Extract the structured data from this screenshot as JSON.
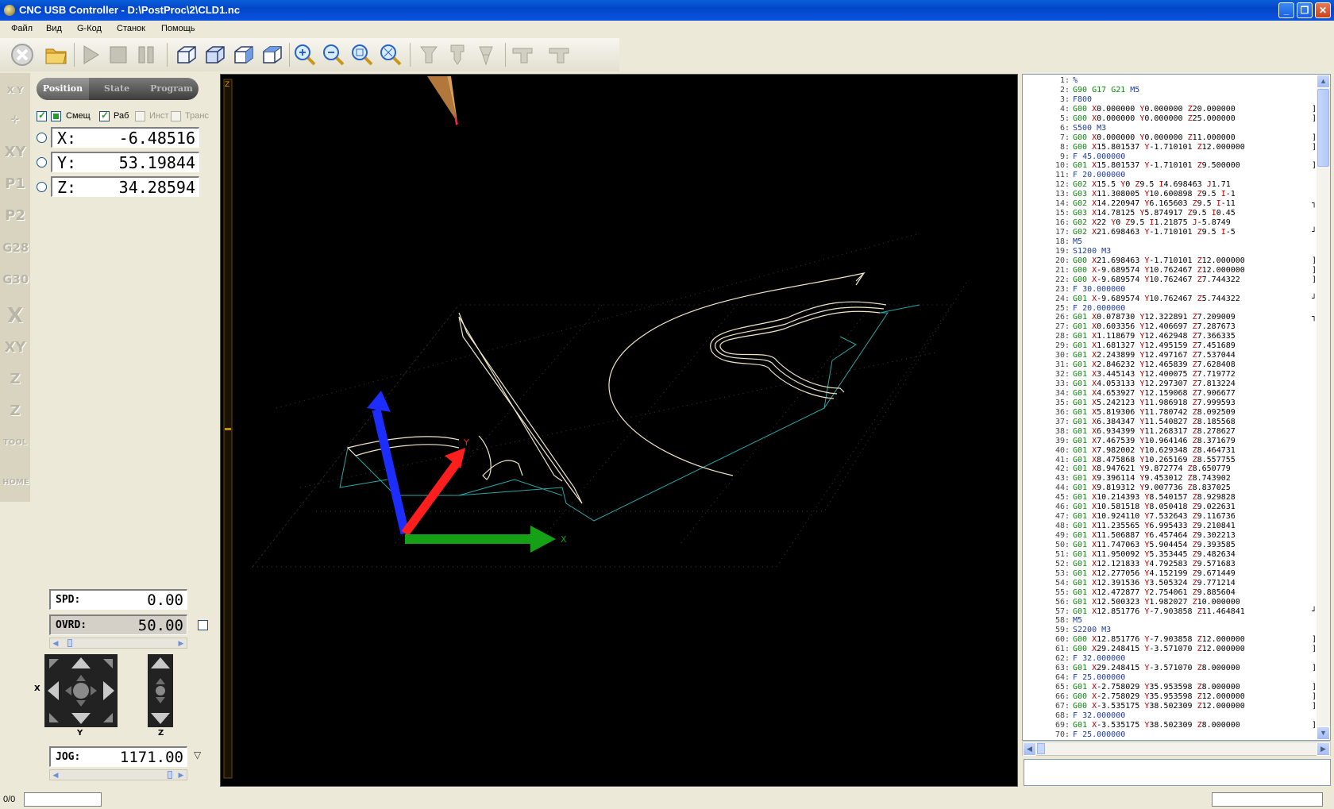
{
  "window": {
    "title": "CNC USB Controller - D:\\PostProc\\2\\CLD1.nc"
  },
  "menu": [
    "Файл",
    "Вид",
    "G-Код",
    "Станок",
    "Помощь"
  ],
  "toolbar": {
    "buttons": [
      "stop-icon",
      "open-folder-icon",
      "play-icon",
      "stop-square-icon",
      "pause-icon",
      "view-3d-icon",
      "view-front-icon",
      "view-side-icon",
      "view-iso-icon",
      "zoom-in-icon",
      "zoom-out-icon",
      "zoom-fit-icon",
      "zoom-window-icon",
      "probe-icon",
      "tool-change-icon",
      "spindle-icon",
      "machine-icon",
      "machine2-icon"
    ]
  },
  "left_sidebar": {
    "icons": [
      "X Y",
      "XY",
      "P1",
      "P2",
      "G28",
      "G30",
      "X",
      "XY",
      "Z",
      "Z",
      "TOOL",
      "HOME"
    ]
  },
  "tabs": {
    "position": "Position",
    "state": "State",
    "program": "Program"
  },
  "coords": {
    "options": {
      "offset": "Смещ",
      "work": "Раб",
      "tool": "Инст",
      "trans": "Транс"
    },
    "x": {
      "label": "X:",
      "value": "-6.48516"
    },
    "y": {
      "label": "Y:",
      "value": "53.19844"
    },
    "z": {
      "label": "Z:",
      "value": "34.28594"
    }
  },
  "spindle": {
    "spd_label": "SPD:",
    "spd_value": "0.00",
    "ovrd_label": "OVRD:",
    "ovrd_value": "50.00"
  },
  "jog": {
    "x_label": "X",
    "y_label": "Y",
    "z_label": "Z",
    "label": "JOG:",
    "value": "1171.00"
  },
  "viewport": {
    "z_axis_label": "Z",
    "axis_x": "X",
    "axis_y": "Y"
  },
  "gcode": [
    {
      "n": "1:",
      "t": "%"
    },
    {
      "n": "2:",
      "t": "G90 G17 G21 M5"
    },
    {
      "n": "3:",
      "t": "F800"
    },
    {
      "n": "4:",
      "t": "G00 X0.000000 Y0.000000 Z20.000000",
      "b": "]"
    },
    {
      "n": "5:",
      "t": "G00 X0.000000 Y0.000000 Z25.000000",
      "b": "]"
    },
    {
      "n": "6:",
      "t": "S500 M3"
    },
    {
      "n": "7:",
      "t": "G00 X0.000000 Y0.000000 Z11.000000",
      "b": "]"
    },
    {
      "n": "8:",
      "t": "G00 X15.801537 Y-1.710101 Z12.000000",
      "b": "]"
    },
    {
      "n": "9:",
      "t": "F 45.000000"
    },
    {
      "n": "10:",
      "t": "G01 X15.801537 Y-1.710101 Z9.500000",
      "b": "]"
    },
    {
      "n": "11:",
      "t": "F 20.000000"
    },
    {
      "n": "12:",
      "t": "G02 X15.5 Y0 Z9.5 I4.698463 J1.71"
    },
    {
      "n": "13:",
      "t": "G03 X11.308005 Y10.600898 Z9.5 I-1"
    },
    {
      "n": "14:",
      "t": "G02 X14.220947 Y6.165603 Z9.5 I-11",
      "b": "┐"
    },
    {
      "n": "15:",
      "t": "G03 X14.78125 Y5.874917 Z9.5 I0.45"
    },
    {
      "n": "16:",
      "t": "G02 X22 Y0 Z9.5 I1.21875 J-5.8749"
    },
    {
      "n": "17:",
      "t": "G02 X21.698463 Y-1.710101 Z9.5 I-5",
      "b": "┘"
    },
    {
      "n": "18:",
      "t": "M5"
    },
    {
      "n": "19:",
      "t": "S1200 M3"
    },
    {
      "n": "20:",
      "t": "G00 X21.698463 Y-1.710101 Z12.000000",
      "b": "]"
    },
    {
      "n": "21:",
      "t": "G00 X-9.689574 Y10.762467 Z12.000000",
      "b": "]"
    },
    {
      "n": "22:",
      "t": "G00 X-9.689574 Y10.762467 Z7.744322",
      "b": "]"
    },
    {
      "n": "23:",
      "t": "F 30.000000"
    },
    {
      "n": "24:",
      "t": "G01 X-9.689574 Y10.762467 Z5.744322",
      "b": "┘"
    },
    {
      "n": "25:",
      "t": "F 20.000000"
    },
    {
      "n": "26:",
      "t": "G01 X0.078730 Y12.322891 Z7.209009",
      "b": "┐"
    },
    {
      "n": "27:",
      "t": "G01 X0.603356 Y12.406697 Z7.287673"
    },
    {
      "n": "28:",
      "t": "G01 X1.118679 Y12.462948 Z7.366335"
    },
    {
      "n": "29:",
      "t": "G01 X1.681327 Y12.495159 Z7.451689"
    },
    {
      "n": "30:",
      "t": "G01 X2.243899 Y12.497167 Z7.537044"
    },
    {
      "n": "31:",
      "t": "G01 X2.846232 Y12.465839 Z7.628408"
    },
    {
      "n": "32:",
      "t": "G01 X3.445143 Y12.400075 Z7.719772"
    },
    {
      "n": "33:",
      "t": "G01 X4.053133 Y12.297307 Z7.813224"
    },
    {
      "n": "34:",
      "t": "G01 X4.653927 Y12.159068 Z7.906677"
    },
    {
      "n": "35:",
      "t": "G01 X5.242123 Y11.986918 Z7.999593"
    },
    {
      "n": "36:",
      "t": "G01 X5.819306 Y11.780742 Z8.092509"
    },
    {
      "n": "37:",
      "t": "G01 X6.384347 Y11.540827 Z8.185568"
    },
    {
      "n": "38:",
      "t": "G01 X6.934399 Y11.268317 Z8.278627"
    },
    {
      "n": "39:",
      "t": "G01 X7.467539 Y10.964146 Z8.371679"
    },
    {
      "n": "40:",
      "t": "G01 X7.982002 Y10.629348 Z8.464731"
    },
    {
      "n": "41:",
      "t": "G01 X8.475868 Y10.265169 Z8.557755"
    },
    {
      "n": "42:",
      "t": "G01 X8.947621 Y9.872774 Z8.650779"
    },
    {
      "n": "43:",
      "t": "G01 X9.396114 Y9.453012 Z8.743902"
    },
    {
      "n": "44:",
      "t": "G01 X9.819312 Y9.007736 Z8.837025"
    },
    {
      "n": "45:",
      "t": "G01 X10.214393 Y8.540157 Z8.929828"
    },
    {
      "n": "46:",
      "t": "G01 X10.581518 Y8.050418 Z9.022631"
    },
    {
      "n": "47:",
      "t": "G01 X10.924110 Y7.532643 Z9.116736"
    },
    {
      "n": "48:",
      "t": "G01 X11.235565 Y6.995433 Z9.210841"
    },
    {
      "n": "49:",
      "t": "G01 X11.506887 Y6.457464 Z9.302213"
    },
    {
      "n": "50:",
      "t": "G01 X11.747063 Y5.904454 Z9.393585"
    },
    {
      "n": "51:",
      "t": "G01 X11.950092 Y5.353445 Z9.482634"
    },
    {
      "n": "52:",
      "t": "G01 X12.121833 Y4.792583 Z9.571683"
    },
    {
      "n": "53:",
      "t": "G01 X12.277056 Y4.152199 Z9.671449"
    },
    {
      "n": "54:",
      "t": "G01 X12.391536 Y3.505324 Z9.771214"
    },
    {
      "n": "55:",
      "t": "G01 X12.472877 Y2.754061 Z9.885604"
    },
    {
      "n": "56:",
      "t": "G01 X12.500323 Y1.982027 Z10.000000"
    },
    {
      "n": "57:",
      "t": "G01 X12.851776 Y-7.903858 Z11.464841",
      "b": "┘"
    },
    {
      "n": "58:",
      "t": "M5"
    },
    {
      "n": "59:",
      "t": "S2200 M3"
    },
    {
      "n": "60:",
      "t": "G00 X12.851776 Y-7.903858 Z12.000000",
      "b": "]"
    },
    {
      "n": "61:",
      "t": "G00 X29.248415 Y-3.571070 Z12.000000",
      "b": "]"
    },
    {
      "n": "62:",
      "t": "F 32.000000"
    },
    {
      "n": "63:",
      "t": "G01 X29.248415 Y-3.571070 Z8.000000",
      "b": "]"
    },
    {
      "n": "64:",
      "t": "F 25.000000"
    },
    {
      "n": "65:",
      "t": "G01 X-2.758029 Y35.953598 Z8.000000",
      "b": "]"
    },
    {
      "n": "66:",
      "t": "G00 X-2.758029 Y35.953598 Z12.000000",
      "b": "]"
    },
    {
      "n": "67:",
      "t": "G00 X-3.535175 Y38.502309 Z12.000000",
      "b": "]"
    },
    {
      "n": "68:",
      "t": "F 32.000000"
    },
    {
      "n": "69:",
      "t": "G01 X-3.535175 Y38.502309 Z8.000000",
      "b": "]"
    },
    {
      "n": "70:",
      "t": "F 25.000000"
    }
  ],
  "status": {
    "progress": "0/0"
  },
  "colors": {
    "title_blue": "#0a52e0",
    "path_white": "#f0e6c8",
    "rapid_cyan": "#2aa6a6",
    "axis_x_green": "#15a015",
    "axis_y_red": "#ff1e1e",
    "axis_z_blue": "#1e2dff"
  }
}
